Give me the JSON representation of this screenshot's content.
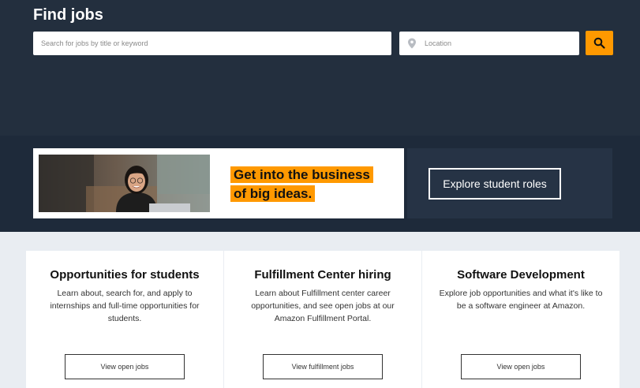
{
  "hero": {
    "title": "Find jobs",
    "search_placeholder": "Search for jobs by title or keyword",
    "location_placeholder": "Location"
  },
  "banner": {
    "headline_line1": "Get into the business",
    "headline_line2": "of big ideas.",
    "cta_label": "Explore student roles"
  },
  "cards": [
    {
      "title": "Opportunities for students",
      "description": "Learn about, search for, and apply to internships and full-time opportunities for students.",
      "button_label": "View open jobs"
    },
    {
      "title": "Fulfillment Center hiring",
      "description": "Learn about Fulfillment center career opportunities, and see open jobs at our Amazon Fulfillment Portal.",
      "button_label": "View fulfillment jobs"
    },
    {
      "title": "Software Development",
      "description": "Explore job opportunities and what it's like to be a software engineer at Amazon.",
      "button_label": "View open jobs"
    }
  ],
  "colors": {
    "hero_bg": "#232f3e",
    "accent": "#ff9900",
    "page_bg": "#e9edf2"
  },
  "icons": {
    "search": "search-icon",
    "location": "location-pin-icon"
  }
}
